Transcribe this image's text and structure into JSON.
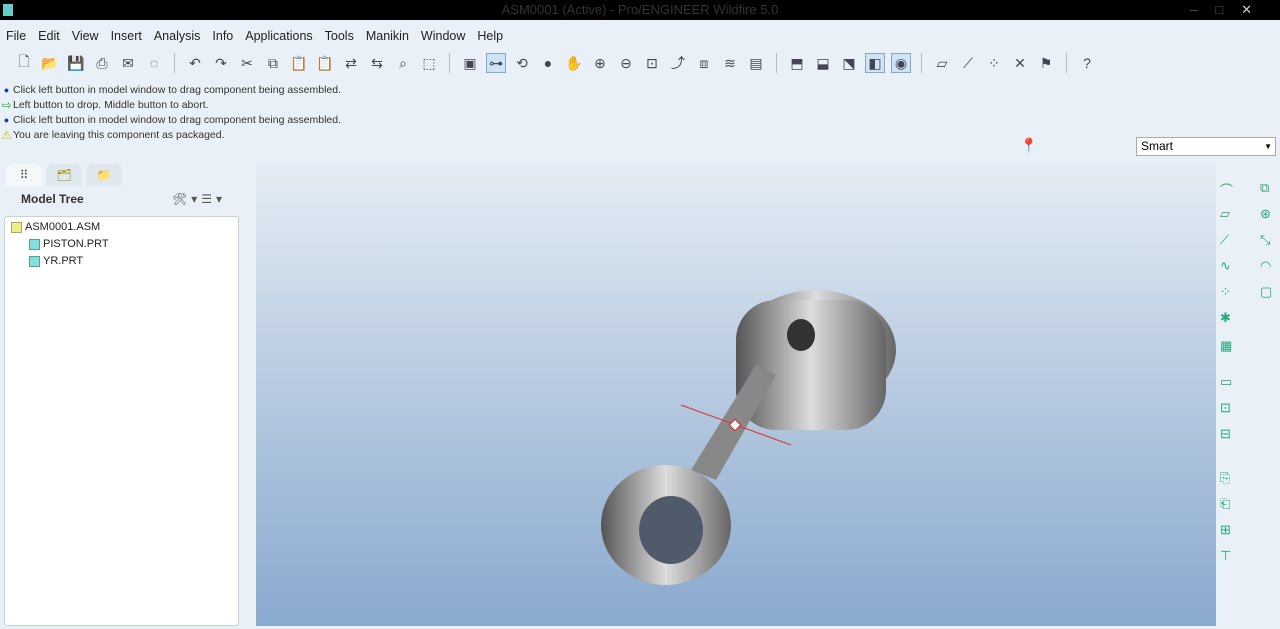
{
  "window": {
    "title": "ASM0001 (Active) - Pro/ENGINEER Wildfire 5.0"
  },
  "menu": [
    "File",
    "Edit",
    "View",
    "Insert",
    "Analysis",
    "Info",
    "Applications",
    "Tools",
    "Manikin",
    "Window",
    "Help"
  ],
  "messages": [
    {
      "icon": "info-dot-icon",
      "text": "Click left button in model window to drag component being assembled."
    },
    {
      "icon": "green-arrow-icon",
      "text": "Left button to drop.  Middle button to abort."
    },
    {
      "icon": "info-dot-icon",
      "text": "Click left button in model window to drag component being assembled."
    },
    {
      "icon": "warning-icon",
      "text": "You are leaving this component as packaged."
    }
  ],
  "filter": {
    "selected": "Smart"
  },
  "model_tree": {
    "title": "Model Tree",
    "items": [
      {
        "label": "ASM0001.ASM",
        "level": 0
      },
      {
        "label": "PISTON.PRT",
        "level": 1
      },
      {
        "label": "YR.PRT",
        "level": 1
      }
    ]
  }
}
